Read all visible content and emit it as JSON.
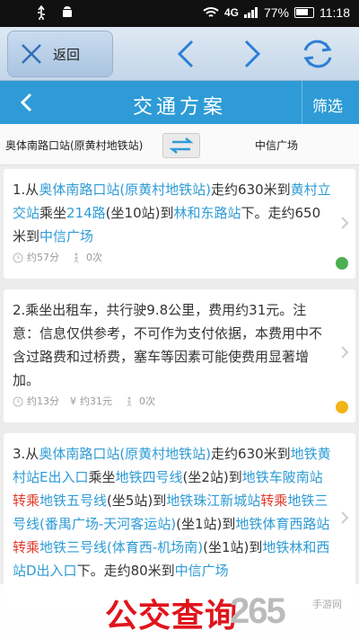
{
  "status_bar": {
    "network": "4G",
    "battery": "77%",
    "time": "11:18"
  },
  "browser": {
    "back_label": "返回"
  },
  "header": {
    "title": "交通方案",
    "filter_label": "筛选"
  },
  "route": {
    "origin": "奥体南路口站(原黄村地铁站)",
    "destination": "中信广场"
  },
  "plans": [
    {
      "segments": [
        {
          "t": "1.从"
        },
        {
          "t": "奥体南路口站(原黄村地铁站)",
          "c": "hl"
        },
        {
          "t": "走约630米到"
        },
        {
          "t": "黄村立交站",
          "c": "hl"
        },
        {
          "t": "乘坐"
        },
        {
          "t": "214路",
          "c": "hl"
        },
        {
          "t": "(坐10站)到"
        },
        {
          "t": "林和东路站",
          "c": "hl"
        },
        {
          "t": "下。走约650米到"
        },
        {
          "t": "中信广场",
          "c": "hl"
        }
      ],
      "time": "约57分",
      "cost": "",
      "transfers": "0次",
      "mode_icon": "bus-icon"
    },
    {
      "segments": [
        {
          "t": "2.乘坐出租车，共行驶9.8公里，费用约31元。注意：信息仅供参考，不可作为支付依据，本费用中不含过路费和过桥费，塞车等因素可能使费用显著增加。"
        }
      ],
      "time": "约13分",
      "cost": "约31元",
      "transfers": "0次",
      "mode_icon": "taxi-icon"
    },
    {
      "segments": [
        {
          "t": "3.从"
        },
        {
          "t": "奥体南路口站(原黄村地铁站)",
          "c": "hl"
        },
        {
          "t": "走约630米到"
        },
        {
          "t": "地铁黄村站E出入口",
          "c": "hl"
        },
        {
          "t": "乘坐"
        },
        {
          "t": "地铁四号线",
          "c": "hl"
        },
        {
          "t": "(坐2站)到"
        },
        {
          "t": "地铁车陂南站",
          "c": "hl"
        },
        {
          "t": "转乘",
          "c": "red"
        },
        {
          "t": "地铁五号线",
          "c": "hl"
        },
        {
          "t": "(坐5站)到"
        },
        {
          "t": "地铁珠江新城站",
          "c": "hl"
        },
        {
          "t": "转乘",
          "c": "red"
        },
        {
          "t": "地铁三号线(番禺广场-天河客运站)",
          "c": "hl"
        },
        {
          "t": "(坐1站)到"
        },
        {
          "t": "地铁体育西路站",
          "c": "hl"
        },
        {
          "t": "转乘",
          "c": "red"
        },
        {
          "t": "地铁三号线(体育西-机场南)",
          "c": "hl"
        },
        {
          "t": "(坐1站)到"
        },
        {
          "t": "地铁林和西站D出入口",
          "c": "hl"
        },
        {
          "t": "下。走约80米到"
        },
        {
          "t": "中信广场",
          "c": "hl"
        }
      ],
      "time": "",
      "cost": "",
      "transfers": "",
      "mode_icon": "subway-icon"
    }
  ],
  "footer": {
    "text": "公交查询",
    "logo": "265",
    "site": "手游网"
  },
  "colors": {
    "accent": "#2e9bd6",
    "transfer": "#e23a2a",
    "banner": "#e0141c"
  }
}
